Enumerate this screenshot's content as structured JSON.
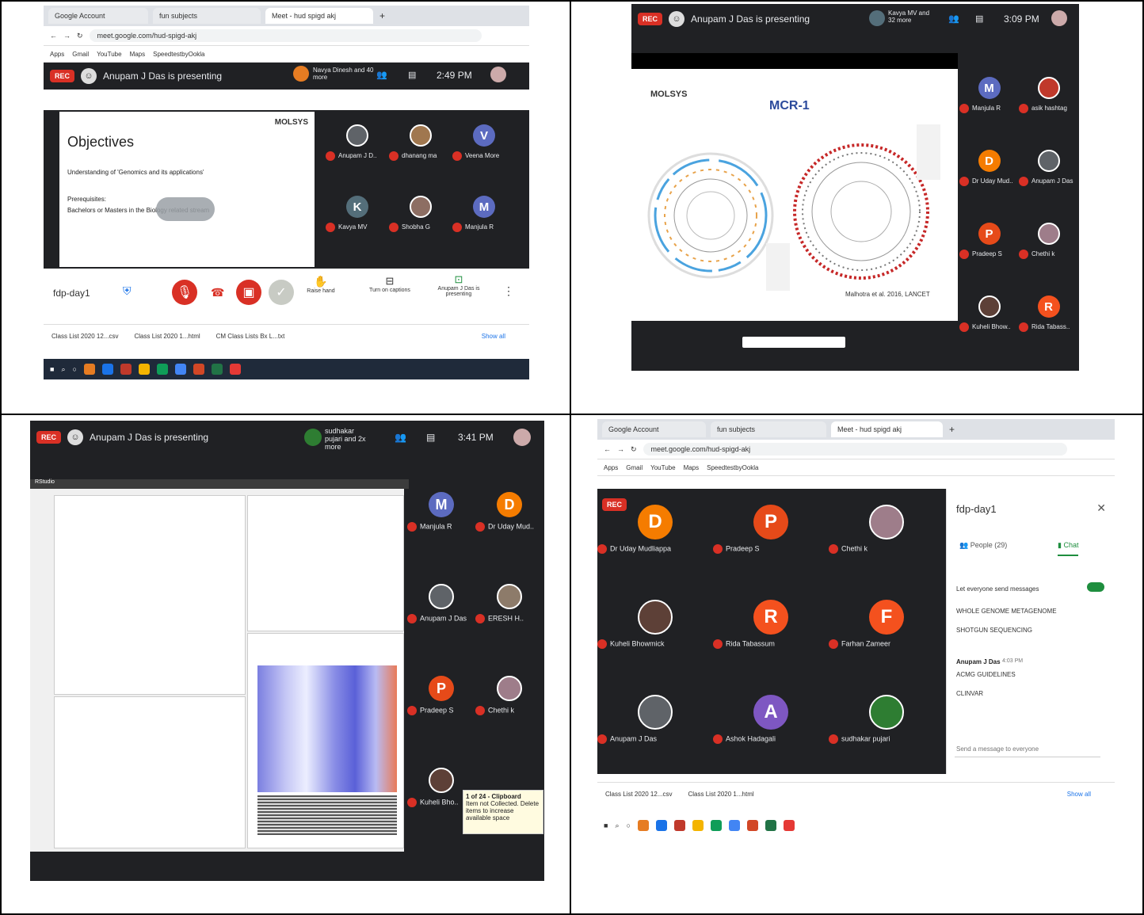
{
  "layout_grid": {
    "rows": 2,
    "cols": 2
  },
  "panel1": {
    "tabs": [
      "Google Account",
      "fun subjects",
      "Meet - hud spigd akj"
    ],
    "url": "meet.google.com/hud-spigd-akj",
    "bookmarks": [
      "Apps",
      "Gmail",
      "YouTube",
      "Maps",
      "SpeedtestbyOokla"
    ],
    "presenting": "Anupam J Das is presenting",
    "rec": "REC",
    "others": "Navya Dinesh and 40 more",
    "time": "2:49 PM",
    "slide_logo": "MOLSYS",
    "slide_title": "Objectives",
    "slide_line1": "Understanding of 'Genomics and its applications'",
    "slide_prereq": "Prerequisites:",
    "slide_line2": "Bachelors or Masters in the Biology related stream",
    "participants": [
      {
        "name": "Anupam J D..",
        "initial": "",
        "color": "#5f6368",
        "photo": true
      },
      {
        "name": "dhanang ma",
        "initial": "",
        "color": "#a0774f",
        "photo": true
      },
      {
        "name": "Veena More",
        "initial": "V",
        "color": "#5c6bc0"
      },
      {
        "name": "Kavya MV",
        "initial": "K",
        "color": "#546e7a"
      },
      {
        "name": "Shobha G",
        "initial": "",
        "color": "#8d6e63",
        "photo": true
      },
      {
        "name": "Manjula R",
        "initial": "M",
        "color": "#5c6bc0"
      }
    ],
    "meeting_name": "fdp-day1",
    "raise_hand": "Raise hand",
    "captions": "Turn on captions",
    "present_label": "Anupam J Das is presenting",
    "downloads": [
      "Class List 2020 12...csv",
      "Class List 2020 1...html",
      "CM Class Lists Bx L...txt"
    ],
    "show_all": "Show all"
  },
  "panel2": {
    "rec": "REC",
    "presenting": "Anupam J Das is presenting",
    "others": "Kavya MV and 32 more",
    "time": "3:09 PM",
    "slide_logo": "MOLSYS",
    "slide_title": "MCR-1",
    "citation": "Malhotra et al. 2016, LANCET",
    "participants": [
      {
        "name": "Manjula R",
        "initial": "M",
        "color": "#5c6bc0"
      },
      {
        "name": "asik hashtag",
        "initial": "",
        "color": "#c0392b",
        "photo": true
      },
      {
        "name": "Dr Uday Mud..",
        "initial": "D",
        "color": "#f57c00"
      },
      {
        "name": "Anupam J Das",
        "initial": "",
        "color": "#5f6368",
        "photo": true
      },
      {
        "name": "Pradeep S",
        "initial": "P",
        "color": "#e64a19"
      },
      {
        "name": "Chethi k",
        "initial": "",
        "color": "#9e7d8a",
        "photo": true
      },
      {
        "name": "Kuheli Bhow..",
        "initial": "",
        "color": "#5d4037",
        "photo": true
      },
      {
        "name": "Rida Tabass..",
        "initial": "R",
        "color": "#f4511e"
      }
    ]
  },
  "panel3": {
    "rec": "REC",
    "presenting": "Anupam J Das is presenting",
    "others": "sudhakar pujari and 2x more",
    "time": "3:41 PM",
    "app": "RStudio",
    "clipboard_title": "1 of 24 - Clipboard",
    "clipboard_text": "Item not Collected. Delete items to increase available space",
    "participants": [
      {
        "name": "Manjula R",
        "initial": "M",
        "color": "#5c6bc0"
      },
      {
        "name": "Dr Uday Mud..",
        "initial": "D",
        "color": "#f57c00"
      },
      {
        "name": "Anupam J Das",
        "initial": "",
        "color": "#5f6368",
        "photo": true
      },
      {
        "name": "ERESH H..",
        "initial": "",
        "color": "#8d7b6a",
        "photo": true
      },
      {
        "name": "Pradeep S",
        "initial": "P",
        "color": "#e64a19"
      },
      {
        "name": "Chethi k",
        "initial": "",
        "color": "#9e7d8a",
        "photo": true
      },
      {
        "name": "Kuheli Bho..",
        "initial": "",
        "color": "#5d4037",
        "photo": true
      }
    ]
  },
  "panel4": {
    "tabs": [
      "Google Account",
      "fun subjects",
      "Meet - hud spigd akj"
    ],
    "url": "meet.google.com/hud-spigd-akj",
    "bookmarks": [
      "Apps",
      "Gmail",
      "YouTube",
      "Maps",
      "SpeedtestbyOokla"
    ],
    "rec": "REC",
    "participants": [
      {
        "name": "Dr Uday Mudliappa",
        "initial": "D",
        "color": "#f57c00"
      },
      {
        "name": "Pradeep S",
        "initial": "P",
        "color": "#e64a19"
      },
      {
        "name": "Chethi k",
        "initial": "",
        "color": "#9e7d8a",
        "photo": true
      },
      {
        "name": "Kuheli Bhowmick",
        "initial": "",
        "color": "#5d4037",
        "photo": true
      },
      {
        "name": "Rida Tabassum",
        "initial": "R",
        "color": "#f4511e"
      },
      {
        "name": "Farhan Zameer",
        "initial": "F",
        "color": "#f4511e"
      },
      {
        "name": "Anupam J Das",
        "initial": "",
        "color": "#5f6368",
        "photo": true
      },
      {
        "name": "Ashok Hadagali",
        "initial": "A",
        "color": "#7e57c2"
      },
      {
        "name": "sudhakar pujari",
        "initial": "",
        "color": "#2e7d32",
        "photo": true
      }
    ],
    "side_title": "fdp-day1",
    "people_tab": "People (29)",
    "chat_tab": "Chat",
    "allow_messages": "Let everyone send messages",
    "chat_lines": [
      "WHOLE GENOME METAGENOME",
      "SHOTGUN SEQUENCING"
    ],
    "chat_sender": "Anupam J Das",
    "chat_sender_time": "4:03 PM",
    "chat_lines2": [
      "ACMG GUIDELINES",
      "CLINVAR"
    ],
    "chat_placeholder": "Send a message to everyone",
    "downloads": [
      "Class List 2020 12...csv",
      "Class List 2020 1...html"
    ],
    "show_all": "Show all"
  },
  "colors": {
    "meet_bg": "#202124",
    "rec_red": "#d93025",
    "taskbar": "#1f2a3a",
    "accent_green": "#1e8e3e"
  }
}
